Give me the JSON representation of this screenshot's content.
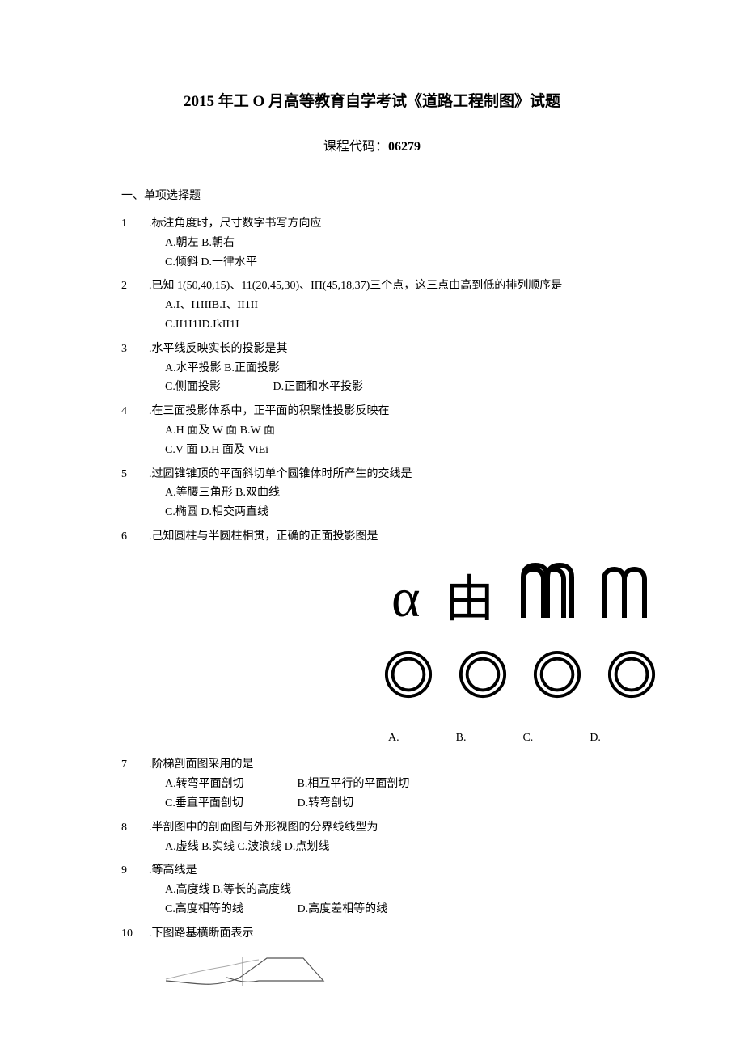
{
  "title": "2015 年工 O 月高等教育自学考试《道路工程制图》试题",
  "sub_title_label": "课程代码：",
  "course_code": "06279",
  "section1": "一、单项选择题",
  "q1": {
    "num": "1",
    "text": ".标注角度时，尺寸数字书写方向应",
    "optA": "A.朝左 B.朝右",
    "optC": "C.倾斜 D.一律水平"
  },
  "q2": {
    "num": "2",
    "text": ".已知 1(50,40,15)、11(20,45,30)、IΠ(45,18,37)三个点，这三点由高到低的排列顺序是",
    "optA": "A.I、I1IIIB.I、II1II",
    "optC": "C.II1I1ID.IkII1I"
  },
  "q3": {
    "num": "3",
    "text": ".水平线反映实长的投影是其",
    "optA": "A.水平投影 B.正面投影",
    "optC": "C.侧面投影",
    "optD": "D.正面和水平投影"
  },
  "q4": {
    "num": "4",
    "text": ".在三面投影体系中，正平面的积聚性投影反映在",
    "optA": "A.H 面及 W 面 B.W 面",
    "optC": "C.V 面 D.H 面及 ViEi"
  },
  "q5": {
    "num": "5",
    "text": ".过圆锥锥顶的平面斜切单个圆锥体时所产生的交线是",
    "optA": "A.等腰三角形 B.双曲线",
    "optC": "C.椭圆 D.相交两直线"
  },
  "q6": {
    "num": "6",
    "text": ".己知圆柱与半圆柱相贯，正确的正面投影图是",
    "letters": {
      "a": "A.",
      "b": "B.",
      "c": "C.",
      "d": "D."
    }
  },
  "q7": {
    "num": "7",
    "text": ".阶梯剖面图采用的是",
    "optA": "A.转弯平面剖切",
    "optB": "B.相互平行的平面剖切",
    "optC": "C.垂直平面剖切",
    "optD": "D.转弯剖切"
  },
  "q8": {
    "num": "8",
    "text": ".半剖图中的剖面图与外形视图的分界线线型为",
    "optA": "A.虚线 B.实线 C.波浪线 D.点划线"
  },
  "q9": {
    "num": "9",
    "text": ".等高线是",
    "optA": "A.高度线 B.等长的高度线",
    "optC": "C.高度相等的线",
    "optD": "D.高度差相等的线"
  },
  "q10": {
    "num": "10",
    "text": ".下图路基横断面表示"
  },
  "glyph_alpha": "α",
  "glyph_you": "由"
}
